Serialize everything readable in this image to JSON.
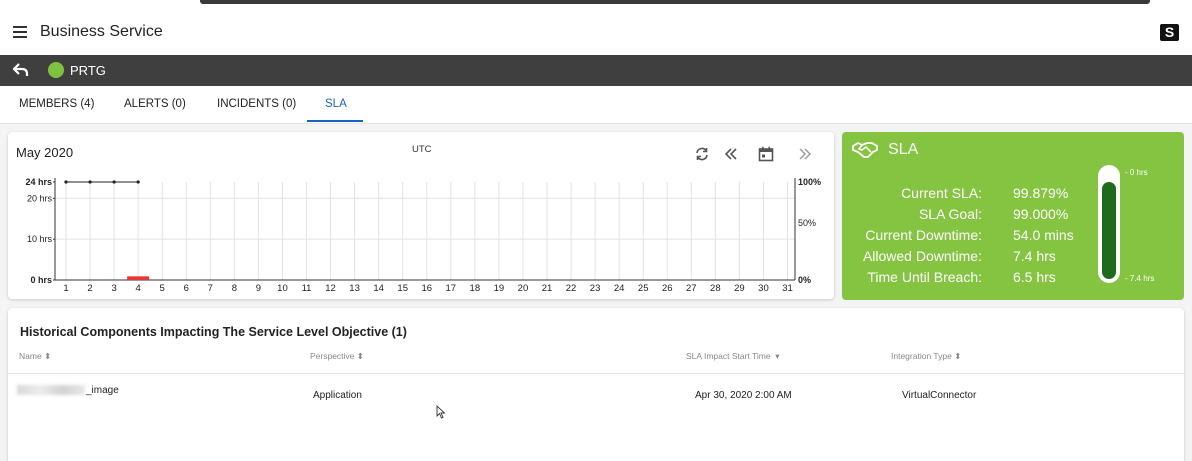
{
  "app": {
    "title": "Business Service"
  },
  "service": {
    "name": "PRTG",
    "status_color": "#7fc241"
  },
  "tabs": [
    {
      "label": "MEMBERS (4)"
    },
    {
      "label": "ALERTS (0)"
    },
    {
      "label": "INCIDENTS (0)"
    },
    {
      "label": "SLA"
    }
  ],
  "active_tab": "SLA",
  "chart": {
    "month": "May 2020",
    "timezone": "UTC"
  },
  "chart_data": {
    "type": "bar",
    "categories": [
      "1",
      "2",
      "3",
      "4",
      "5",
      "6",
      "7",
      "8",
      "9",
      "10",
      "11",
      "12",
      "13",
      "14",
      "15",
      "16",
      "17",
      "18",
      "19",
      "20",
      "21",
      "22",
      "23",
      "24",
      "25",
      "26",
      "27",
      "28",
      "29",
      "30",
      "31"
    ],
    "left_axis_ticks": [
      "24 hrs",
      "20 hrs",
      "10 hrs",
      "0 hrs"
    ],
    "right_axis_ticks": [
      "100%",
      "50%",
      "0%"
    ],
    "ylim": [
      0,
      24
    ],
    "uptime_line": {
      "x": [
        1,
        2,
        3,
        4
      ],
      "y": [
        24,
        24,
        24,
        24
      ]
    },
    "downtime_bars": [
      {
        "x": 4,
        "value": 0.9,
        "color": "#e53935"
      }
    ],
    "grid": true
  },
  "sla": {
    "title": "SLA",
    "rows": [
      {
        "label": "Current SLA:",
        "value": "99.879%"
      },
      {
        "label": "SLA Goal:",
        "value": "99.000%"
      },
      {
        "label": "Current Downtime:",
        "value": "54.0 mins"
      },
      {
        "label": "Allowed Downtime:",
        "value": "7.4 hrs"
      },
      {
        "label": "Time Until Breach:",
        "value": "6.5 hrs"
      }
    ],
    "gauge_top_label": "- 0 hrs",
    "gauge_bottom_label": "- 7.4 hrs",
    "gauge_fill_fraction": 0.88,
    "card_color": "#84c441",
    "gauge_color": "#1e6b1e"
  },
  "history": {
    "title": "Historical Components Impacting The Service Level Objective (1)",
    "columns": [
      "Name",
      "Perspective",
      "SLA Impact Start Time",
      "Integration Type"
    ],
    "rows": [
      {
        "name_suffix": "_image",
        "perspective": "Application",
        "start_time": "Apr 30, 2020 2:00 AM",
        "integration": "VirtualConnector"
      }
    ]
  }
}
